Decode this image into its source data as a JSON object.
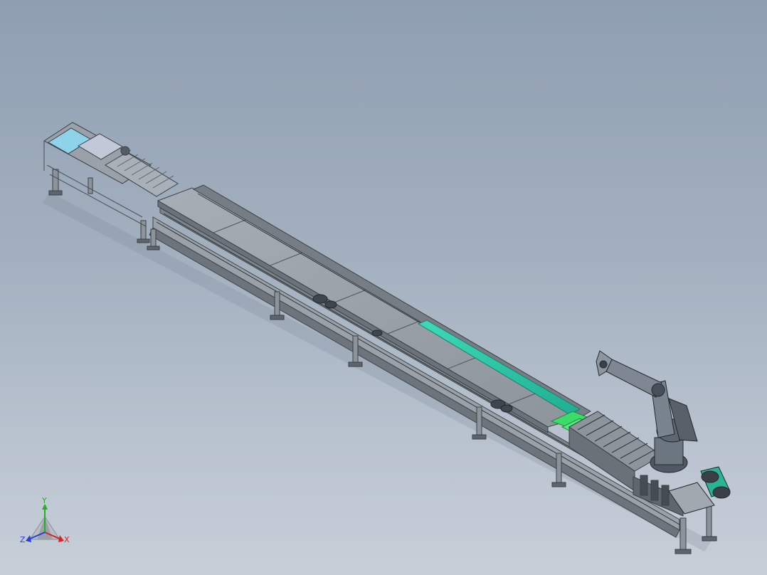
{
  "scene": {
    "type": "3d-cad-model-view",
    "background_top_color": "#8f9fb2",
    "background_bottom_color": "#c7cfd8",
    "model_colors": {
      "frame": "#8d949c",
      "frame_dark": "#4e555c",
      "platform": "#9aa1a8",
      "teal_belt": "#2fc6a6",
      "green_part": "#3ddc6a",
      "light_blue_panel": "#8fd3ea",
      "robot": "#6c7680"
    }
  },
  "triad": {
    "x_label": "X",
    "y_label": "Y",
    "z_label": "Z",
    "x_color": "#d22424",
    "y_color": "#22b022",
    "z_color": "#2a3fd6"
  }
}
